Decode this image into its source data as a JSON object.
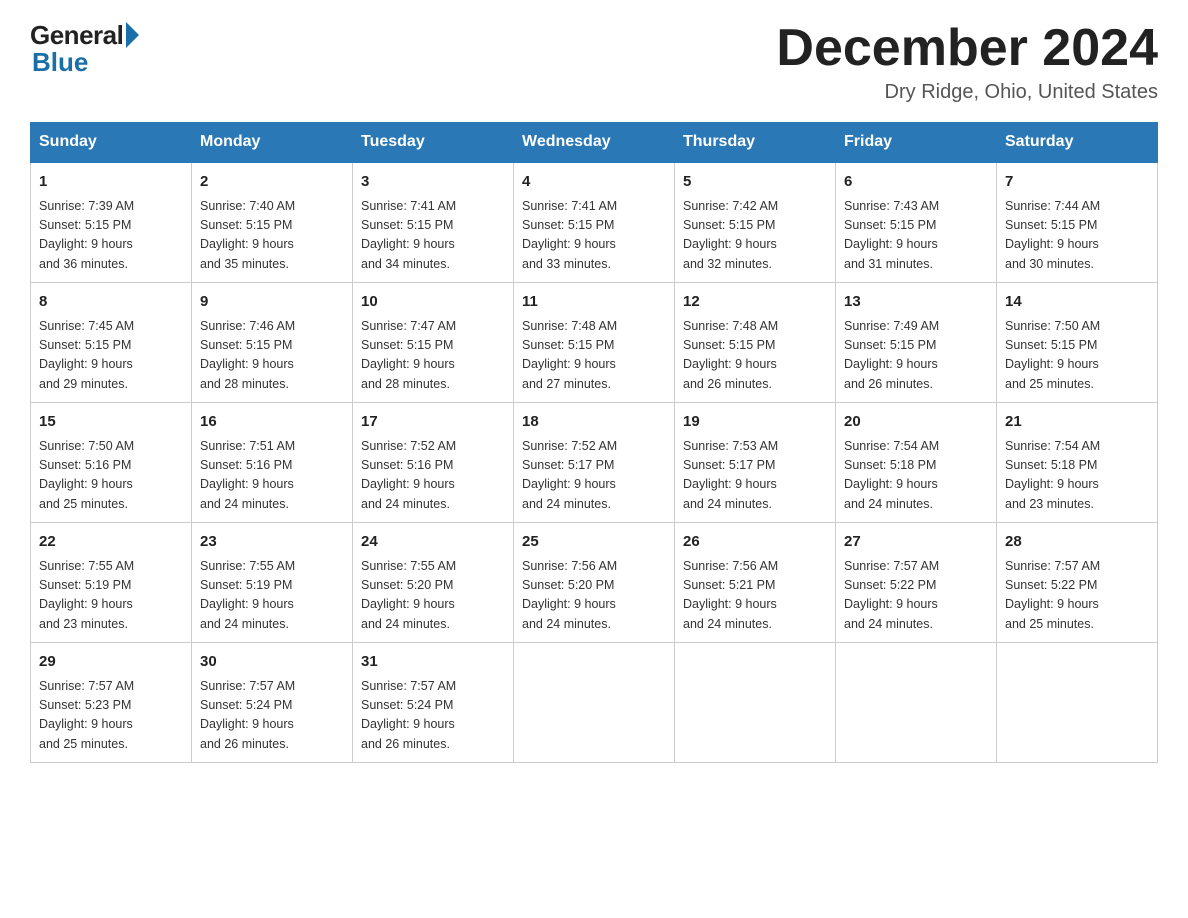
{
  "logo": {
    "general": "General",
    "blue": "Blue"
  },
  "title": "December 2024",
  "location": "Dry Ridge, Ohio, United States",
  "days_of_week": [
    "Sunday",
    "Monday",
    "Tuesday",
    "Wednesday",
    "Thursday",
    "Friday",
    "Saturday"
  ],
  "weeks": [
    [
      {
        "day": "1",
        "sunrise": "7:39 AM",
        "sunset": "5:15 PM",
        "daylight": "9 hours and 36 minutes."
      },
      {
        "day": "2",
        "sunrise": "7:40 AM",
        "sunset": "5:15 PM",
        "daylight": "9 hours and 35 minutes."
      },
      {
        "day": "3",
        "sunrise": "7:41 AM",
        "sunset": "5:15 PM",
        "daylight": "9 hours and 34 minutes."
      },
      {
        "day": "4",
        "sunrise": "7:41 AM",
        "sunset": "5:15 PM",
        "daylight": "9 hours and 33 minutes."
      },
      {
        "day": "5",
        "sunrise": "7:42 AM",
        "sunset": "5:15 PM",
        "daylight": "9 hours and 32 minutes."
      },
      {
        "day": "6",
        "sunrise": "7:43 AM",
        "sunset": "5:15 PM",
        "daylight": "9 hours and 31 minutes."
      },
      {
        "day": "7",
        "sunrise": "7:44 AM",
        "sunset": "5:15 PM",
        "daylight": "9 hours and 30 minutes."
      }
    ],
    [
      {
        "day": "8",
        "sunrise": "7:45 AM",
        "sunset": "5:15 PM",
        "daylight": "9 hours and 29 minutes."
      },
      {
        "day": "9",
        "sunrise": "7:46 AM",
        "sunset": "5:15 PM",
        "daylight": "9 hours and 28 minutes."
      },
      {
        "day": "10",
        "sunrise": "7:47 AM",
        "sunset": "5:15 PM",
        "daylight": "9 hours and 28 minutes."
      },
      {
        "day": "11",
        "sunrise": "7:48 AM",
        "sunset": "5:15 PM",
        "daylight": "9 hours and 27 minutes."
      },
      {
        "day": "12",
        "sunrise": "7:48 AM",
        "sunset": "5:15 PM",
        "daylight": "9 hours and 26 minutes."
      },
      {
        "day": "13",
        "sunrise": "7:49 AM",
        "sunset": "5:15 PM",
        "daylight": "9 hours and 26 minutes."
      },
      {
        "day": "14",
        "sunrise": "7:50 AM",
        "sunset": "5:15 PM",
        "daylight": "9 hours and 25 minutes."
      }
    ],
    [
      {
        "day": "15",
        "sunrise": "7:50 AM",
        "sunset": "5:16 PM",
        "daylight": "9 hours and 25 minutes."
      },
      {
        "day": "16",
        "sunrise": "7:51 AM",
        "sunset": "5:16 PM",
        "daylight": "9 hours and 24 minutes."
      },
      {
        "day": "17",
        "sunrise": "7:52 AM",
        "sunset": "5:16 PM",
        "daylight": "9 hours and 24 minutes."
      },
      {
        "day": "18",
        "sunrise": "7:52 AM",
        "sunset": "5:17 PM",
        "daylight": "9 hours and 24 minutes."
      },
      {
        "day": "19",
        "sunrise": "7:53 AM",
        "sunset": "5:17 PM",
        "daylight": "9 hours and 24 minutes."
      },
      {
        "day": "20",
        "sunrise": "7:54 AM",
        "sunset": "5:18 PM",
        "daylight": "9 hours and 24 minutes."
      },
      {
        "day": "21",
        "sunrise": "7:54 AM",
        "sunset": "5:18 PM",
        "daylight": "9 hours and 23 minutes."
      }
    ],
    [
      {
        "day": "22",
        "sunrise": "7:55 AM",
        "sunset": "5:19 PM",
        "daylight": "9 hours and 23 minutes."
      },
      {
        "day": "23",
        "sunrise": "7:55 AM",
        "sunset": "5:19 PM",
        "daylight": "9 hours and 24 minutes."
      },
      {
        "day": "24",
        "sunrise": "7:55 AM",
        "sunset": "5:20 PM",
        "daylight": "9 hours and 24 minutes."
      },
      {
        "day": "25",
        "sunrise": "7:56 AM",
        "sunset": "5:20 PM",
        "daylight": "9 hours and 24 minutes."
      },
      {
        "day": "26",
        "sunrise": "7:56 AM",
        "sunset": "5:21 PM",
        "daylight": "9 hours and 24 minutes."
      },
      {
        "day": "27",
        "sunrise": "7:57 AM",
        "sunset": "5:22 PM",
        "daylight": "9 hours and 24 minutes."
      },
      {
        "day": "28",
        "sunrise": "7:57 AM",
        "sunset": "5:22 PM",
        "daylight": "9 hours and 25 minutes."
      }
    ],
    [
      {
        "day": "29",
        "sunrise": "7:57 AM",
        "sunset": "5:23 PM",
        "daylight": "9 hours and 25 minutes."
      },
      {
        "day": "30",
        "sunrise": "7:57 AM",
        "sunset": "5:24 PM",
        "daylight": "9 hours and 26 minutes."
      },
      {
        "day": "31",
        "sunrise": "7:57 AM",
        "sunset": "5:24 PM",
        "daylight": "9 hours and 26 minutes."
      },
      null,
      null,
      null,
      null
    ]
  ],
  "labels": {
    "sunrise": "Sunrise:",
    "sunset": "Sunset:",
    "daylight": "Daylight:"
  }
}
